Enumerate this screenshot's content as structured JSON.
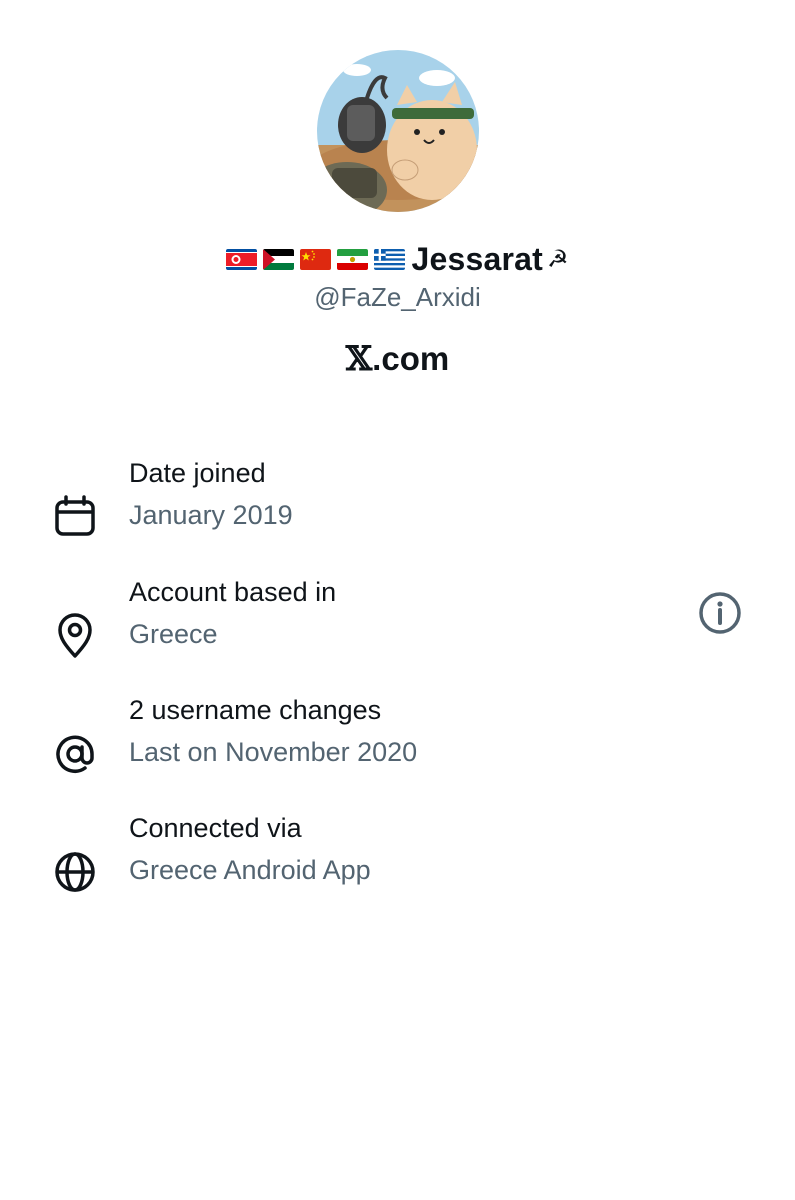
{
  "profile": {
    "display_name": "Jessarat",
    "name_symbol": "☭",
    "handle": "@FaZe_Arxidi",
    "flags": [
      "north-korea-flag",
      "palestine-flag",
      "china-flag",
      "iran-flag",
      "greece-flag"
    ],
    "avatar": "cartoon-cat-avatar"
  },
  "brand": {
    "x_glyph": "𝕏",
    "domain": ".com"
  },
  "details": [
    {
      "icon": "calendar-icon",
      "title": "Date joined",
      "subtitle": "January 2019"
    },
    {
      "icon": "location-pin-icon",
      "title": "Account based in",
      "subtitle": "Greece"
    },
    {
      "icon": "at-sign-icon",
      "title": "2 username changes",
      "subtitle": "Last on November 2020"
    },
    {
      "icon": "globe-icon",
      "title": "Connected via",
      "subtitle": "Greece Android App"
    }
  ],
  "colors": {
    "primary_text": "#0f1419",
    "secondary_text": "#536471",
    "background": "#ffffff"
  }
}
